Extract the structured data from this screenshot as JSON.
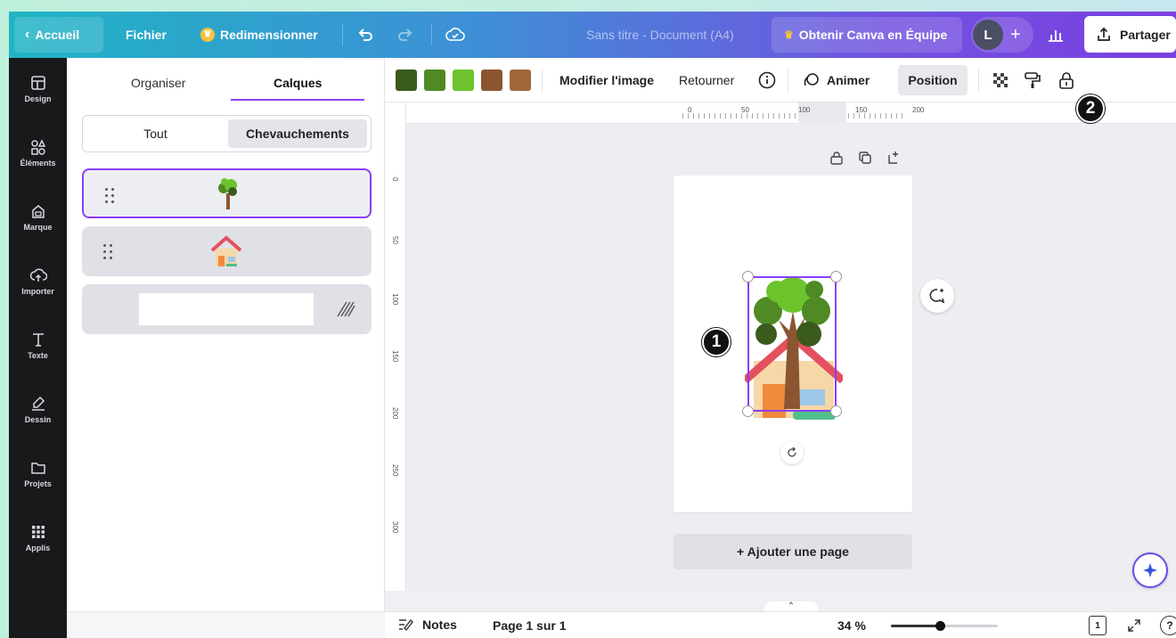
{
  "topbar": {
    "back_label": "Accueil",
    "file_label": "Fichier",
    "resize_label": "Redimensionner",
    "doc_title": "Sans titre - Document (A4)",
    "team_label": "Obtenir Canva en Équipe",
    "avatar_initial": "L",
    "plus_label": "+",
    "share_label": "Partager"
  },
  "rail": {
    "items": [
      {
        "label": "Design",
        "icon": "layout-icon"
      },
      {
        "label": "Éléments",
        "icon": "shapes-icon"
      },
      {
        "label": "Marque",
        "icon": "brand-icon"
      },
      {
        "label": "Importer",
        "icon": "upload-cloud-icon"
      },
      {
        "label": "Texte",
        "icon": "text-icon"
      },
      {
        "label": "Dessin",
        "icon": "draw-icon"
      },
      {
        "label": "Projets",
        "icon": "folder-icon"
      },
      {
        "label": "Applis",
        "icon": "apps-grid-icon"
      }
    ]
  },
  "panel": {
    "tab_organize": "Organiser",
    "tab_layers": "Calques",
    "seg_all": "Tout",
    "seg_overlaps": "Chevauchements"
  },
  "toolbar": {
    "swatches": [
      "#3a5a1e",
      "#4f8a24",
      "#6cc32c",
      "#8a5530",
      "#a0673a"
    ],
    "edit_image": "Modifier l'image",
    "flip": "Retourner",
    "animate": "Animer",
    "position": "Position"
  },
  "rulers": {
    "h": [
      "0",
      "50",
      "100",
      "150",
      "200"
    ],
    "v": [
      "0",
      "50",
      "100",
      "150",
      "200",
      "250",
      "300"
    ]
  },
  "canvas": {
    "add_page": "+ Ajouter une page",
    "badge_1": "1",
    "badge_2": "2"
  },
  "bottombar": {
    "notes": "Notes",
    "page_info": "Page 1 sur 1",
    "zoom": "34 %",
    "page_count": "1",
    "help": "?"
  },
  "colors": {
    "accent": "#8b3dff",
    "rail": "#18191b"
  }
}
